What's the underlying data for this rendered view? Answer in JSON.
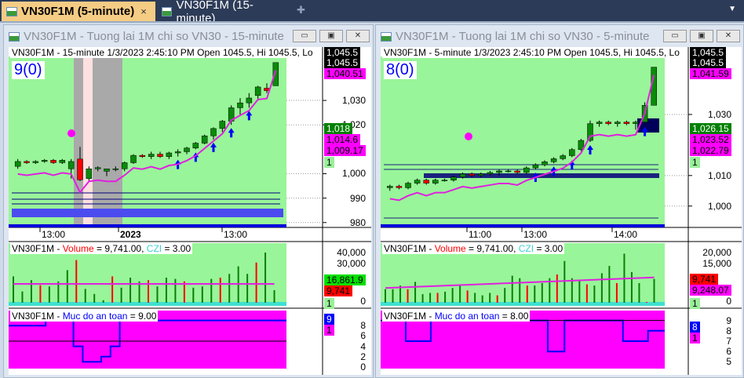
{
  "tabs": [
    {
      "label": "VN30F1M (5-minute)",
      "active": true,
      "close": "×"
    },
    {
      "label": "VN30F1M (15-minute)",
      "active": false
    }
  ],
  "tab_add": "✚",
  "tab_dropdown": "▼",
  "windows": [
    {
      "title": "VN30F1M - Tuong lai 1M chi so VN30 - 15-minute",
      "header": "VN30F1M - 15-minute 1/3/2023 2:45:10 PM Open 1045.5, Hi 1045.5, Lo",
      "counter": "9(0)",
      "price_ticks": [
        "1,030",
        "1,020",
        "1,000",
        "990",
        "980"
      ],
      "price_tags": [
        {
          "text": "1,045.5",
          "bg": "#000",
          "fg": "#fff"
        },
        {
          "text": "1,045.5",
          "bg": "#000",
          "fg": "#fff"
        },
        {
          "text": "1,040.51",
          "bg": "#ff00ff",
          "fg": "#000"
        },
        {
          "text": "1,018",
          "bg": "#008000",
          "fg": "#fff"
        },
        {
          "text": "1,014.6",
          "bg": "#ff00ff",
          "fg": "#000"
        },
        {
          "text": "1,009.17",
          "bg": "#ff00ff",
          "fg": "#000"
        },
        {
          "text": "1",
          "bg": "#99f099",
          "fg": "#000"
        }
      ],
      "time_labels": [
        "13:00",
        "2023",
        "13:00"
      ],
      "vol_title": {
        "prefix": "VN30F1M - ",
        "vol": "Volume",
        "mid": " = 9,741.00, ",
        "czi": "CZI",
        "end": " = 3.00"
      },
      "vol_ticks": [
        "40,000",
        "30,000",
        "0"
      ],
      "vol_tags": [
        {
          "text": "16,861.9",
          "bg": "#00e000",
          "fg": "#000"
        },
        {
          "text": "9,741",
          "bg": "#ff0000",
          "fg": "#000"
        },
        {
          "text": "1",
          "bg": "#99f099",
          "fg": "#000"
        }
      ],
      "safe_title": {
        "prefix": "VN30F1M - ",
        "name": "Muc do an toan",
        "end": " = 9.00"
      },
      "safe_ticks": [
        "8",
        "6",
        "4",
        "2",
        "0"
      ],
      "safe_tags": [
        {
          "text": "9",
          "bg": "#0000ff",
          "fg": "#fff"
        },
        {
          "text": "1",
          "bg": "#ff00ff",
          "fg": "#000"
        }
      ],
      "candles": [
        [
          1003,
          1006,
          1002,
          1005
        ],
        [
          1005,
          1005.5,
          1004,
          1004.5
        ],
        [
          1004.5,
          1005.5,
          1004,
          1005
        ],
        [
          1005,
          1006,
          1004.5,
          1005.5
        ],
        [
          1005.5,
          1006,
          1004,
          1004.5
        ],
        [
          1004.5,
          1006,
          1004,
          1005.5
        ],
        [
          1002,
          1006,
          998,
          1005
        ],
        [
          1006,
          1011,
          997,
          997.5
        ],
        [
          998,
          1003,
          997,
          1002
        ],
        [
          1002,
          1003,
          1001,
          1002.5
        ],
        [
          1001,
          1002,
          999,
          1002
        ],
        [
          1002,
          1003,
          1001,
          1002
        ],
        [
          1002,
          1005,
          1001,
          1004.5
        ],
        [
          1004.5,
          1008,
          1004,
          1007.5
        ],
        [
          1007.5,
          1008,
          1006.5,
          1007
        ],
        [
          1007,
          1009,
          1006,
          1008
        ],
        [
          1008,
          1009,
          1006.5,
          1007
        ],
        [
          1007,
          1009,
          1006,
          1008.5
        ],
        [
          1008.5,
          1010,
          1007,
          1009
        ],
        [
          1009,
          1011,
          1008,
          1010.5
        ],
        [
          1010.5,
          1013,
          1010,
          1012.5
        ],
        [
          1012.5,
          1016,
          1012,
          1015.5
        ],
        [
          1015.5,
          1019,
          1014,
          1018.5
        ],
        [
          1018.5,
          1022,
          1017,
          1021.5
        ],
        [
          1021.5,
          1028,
          1020,
          1027
        ],
        [
          1027,
          1031,
          1024,
          1029
        ],
        [
          1029,
          1033,
          1027,
          1031
        ],
        [
          1032,
          1036,
          1030,
          1035.5
        ],
        [
          1035,
          1037,
          1033,
          1034
        ],
        [
          1036,
          1045.5,
          1036,
          1045.5
        ]
      ],
      "volumes": [
        21,
        9,
        18,
        14,
        13,
        17,
        26,
        34,
        11,
        7,
        2,
        21,
        12,
        20,
        17,
        18,
        13,
        20,
        19,
        17,
        12,
        13,
        19,
        20,
        23,
        29,
        23,
        32,
        40,
        10
      ],
      "safety": [
        8,
        8,
        8,
        8,
        9,
        9,
        9,
        4,
        1,
        1,
        2,
        4,
        9,
        9,
        9,
        9,
        9,
        9,
        9,
        9,
        9,
        9,
        9,
        9,
        9,
        9,
        9,
        9,
        9,
        9
      ]
    },
    {
      "title": "VN30F1M - Tuong lai 1M chi so VN30 - 5-minute",
      "header": "VN30F1M - 5-minute 1/3/2023 2:45:10 PM Open 1045.5, Hi 1045.5, Lo",
      "counter": "8(0)",
      "price_ticks": [
        "1,030",
        "1,010",
        "1,000"
      ],
      "price_tags": [
        {
          "text": "1,045.5",
          "bg": "#000",
          "fg": "#fff"
        },
        {
          "text": "1,045.5",
          "bg": "#000",
          "fg": "#fff"
        },
        {
          "text": "1,041.59",
          "bg": "#ff00ff",
          "fg": "#000"
        },
        {
          "text": "1,026.15",
          "bg": "#008000",
          "fg": "#fff"
        },
        {
          "text": "1,023.52",
          "bg": "#ff00ff",
          "fg": "#000"
        },
        {
          "text": "1,022.79",
          "bg": "#ff00ff",
          "fg": "#000"
        },
        {
          "text": "1",
          "bg": "#99f099",
          "fg": "#000"
        }
      ],
      "time_labels": [
        "11:00",
        "13:00",
        "14:00"
      ],
      "vol_title": {
        "prefix": "VN30F1M - ",
        "vol": "Volume",
        "mid": " = 9,741.00, ",
        "czi": "CZI",
        "end": " = 3.00"
      },
      "vol_ticks": [
        "20,000",
        "15,000",
        "0"
      ],
      "vol_tags": [
        {
          "text": "9,741",
          "bg": "#ff0000",
          "fg": "#000"
        },
        {
          "text": "9,248.07",
          "bg": "#ff00ff",
          "fg": "#000"
        },
        {
          "text": "1",
          "bg": "#99f099",
          "fg": "#000"
        }
      ],
      "safe_title": {
        "prefix": "VN30F1M - ",
        "name": "Muc do an toan",
        "end": " = 8.00"
      },
      "safe_ticks": [
        "9",
        "8",
        "7",
        "6",
        "5"
      ],
      "safe_tags": [
        {
          "text": "8",
          "bg": "#0000ff",
          "fg": "#fff"
        },
        {
          "text": "1",
          "bg": "#ff00ff",
          "fg": "#000"
        }
      ],
      "candles": [
        [
          1006,
          1007,
          1005,
          1006.5
        ],
        [
          1006.5,
          1007,
          1005.5,
          1006
        ],
        [
          1006,
          1008,
          1005.5,
          1007.5
        ],
        [
          1007.5,
          1009,
          1007,
          1008.5
        ],
        [
          1008.5,
          1009,
          1007,
          1007.5
        ],
        [
          1007.5,
          1009,
          1007,
          1008.5
        ],
        [
          1008.5,
          1009,
          1008,
          1008.5
        ],
        [
          1008.5,
          1010,
          1008,
          1009.5
        ],
        [
          1009.5,
          1011,
          1009,
          1010.5
        ],
        [
          1010.5,
          1011,
          1009.5,
          1010
        ],
        [
          1010,
          1011,
          1009.5,
          1010.5
        ],
        [
          1010.5,
          1011.5,
          1010,
          1011
        ],
        [
          1011,
          1012,
          1010,
          1011.5
        ],
        [
          1011.5,
          1012,
          1011,
          1011.5
        ],
        [
          1011.5,
          1012,
          1010.5,
          1011
        ],
        [
          1011,
          1013,
          1010.5,
          1012.5
        ],
        [
          1012.5,
          1014,
          1012,
          1013.5
        ],
        [
          1013.5,
          1015,
          1013,
          1014.5
        ],
        [
          1014.5,
          1016,
          1014,
          1015.5
        ],
        [
          1015.5,
          1017,
          1015,
          1016.5
        ],
        [
          1016.5,
          1019,
          1016,
          1018.5
        ],
        [
          1018.5,
          1022,
          1018,
          1021.5
        ],
        [
          1021.5,
          1028,
          1021,
          1027
        ],
        [
          1027,
          1028,
          1026,
          1027.5
        ],
        [
          1027.5,
          1028,
          1026.5,
          1027
        ],
        [
          1027,
          1028,
          1026,
          1027.5
        ],
        [
          1027.5,
          1028,
          1026.5,
          1027
        ],
        [
          1027,
          1028,
          1025,
          1027.5
        ],
        [
          1027.5,
          1034,
          1027,
          1033
        ],
        [
          1033,
          1045.5,
          1033,
          1045.5
        ]
      ],
      "volumes": [
        5.5,
        5.5,
        7,
        5.5,
        8.5,
        3.5,
        4,
        4,
        4.5,
        6,
        7,
        5,
        4,
        3,
        4,
        3,
        6,
        11,
        10,
        7,
        7,
        8,
        10,
        11.5,
        17,
        10,
        9,
        7.5,
        7,
        12,
        15,
        8,
        20,
        12.5,
        8,
        0.3,
        9.7
      ],
      "safety": [
        9,
        9,
        9,
        7,
        7,
        7,
        9,
        9,
        9,
        9,
        9,
        9,
        9,
        9,
        9,
        9,
        9,
        9,
        9,
        9,
        6,
        6,
        9,
        9,
        9,
        9,
        9,
        9,
        9,
        7,
        7,
        7,
        8,
        8
      ]
    }
  ]
}
